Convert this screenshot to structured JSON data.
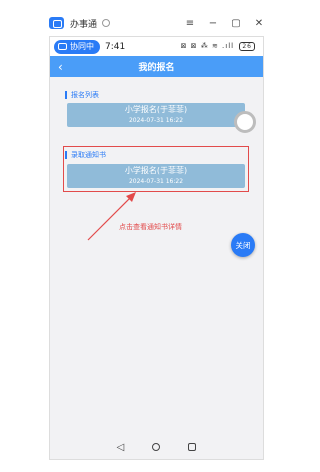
{
  "window": {
    "app_name": "办事通"
  },
  "status_bar": {
    "collab_label": "协同中",
    "time": "7:41",
    "icons": "⊠ ⊠ ⁂ ≋ .ıll",
    "battery": "26"
  },
  "navbar": {
    "title": "我的报名"
  },
  "sections": [
    {
      "label": "报名列表",
      "card": {
        "title": "小学报名(于菲菲)",
        "date": "2024-07-31 16:22"
      }
    },
    {
      "label": "录取通知书",
      "card": {
        "title": "小学报名(于菲菲)",
        "date": "2024-07-31 16:22"
      }
    }
  ],
  "annotation": {
    "hint": "点击查看通知书详情",
    "color": "#e24b4b"
  },
  "close_button": {
    "label": "关闭"
  },
  "colors": {
    "accent": "#2a7bf6",
    "navbar": "#4a9df8",
    "card": "#90bbd9"
  }
}
